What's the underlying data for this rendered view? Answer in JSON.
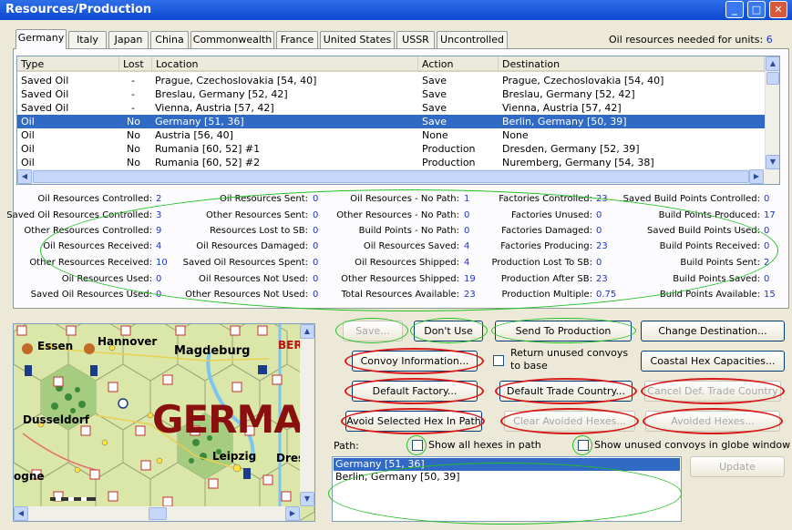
{
  "window": {
    "title": "Resources/Production"
  },
  "tabs": [
    {
      "label": "Germany",
      "active": true
    },
    {
      "label": "Italy"
    },
    {
      "label": "Japan"
    },
    {
      "label": "China"
    },
    {
      "label": "Commonwealth"
    },
    {
      "label": "France"
    },
    {
      "label": "United States"
    },
    {
      "label": "USSR"
    },
    {
      "label": "Uncontrolled"
    }
  ],
  "oil_needed": {
    "label": "Oil resources needed for units:",
    "value": "6"
  },
  "table": {
    "columns": [
      "Type",
      "Lost",
      "Location",
      "Action",
      "Destination"
    ],
    "rows": [
      {
        "type": "Saved Oil",
        "lost": "-",
        "location": "Prague, Czechoslovakia [54, 40]",
        "action": "Save",
        "destination": "Prague, Czechoslovakia [54, 40]"
      },
      {
        "type": "Saved Oil",
        "lost": "-",
        "location": "Breslau, Germany [52, 42]",
        "action": "Save",
        "destination": "Breslau, Germany [52, 42]"
      },
      {
        "type": "Saved Oil",
        "lost": "-",
        "location": "Vienna, Austria [57, 42]",
        "action": "Save",
        "destination": "Vienna, Austria [57, 42]"
      },
      {
        "type": "Oil",
        "lost": "No",
        "location": "Germany [51, 36]",
        "action": "Save",
        "destination": "Berlin, Germany [50, 39]",
        "selected": true
      },
      {
        "type": "Oil",
        "lost": "No",
        "location": "Austria [56, 40]",
        "action": "None",
        "destination": "None"
      },
      {
        "type": "Oil",
        "lost": "No",
        "location": "Rumania [60, 52] #1",
        "action": "Production",
        "destination": "Dresden, Germany [52, 39]"
      },
      {
        "type": "Oil",
        "lost": "No",
        "location": "Rumania [60, 52] #2",
        "action": "Production",
        "destination": "Nuremberg, Germany [54, 38]"
      }
    ]
  },
  "stats": {
    "col1": [
      {
        "label": "Oil Resources Controlled:",
        "value": "2"
      },
      {
        "label": "Saved Oil Resources Controlled:",
        "value": "3"
      },
      {
        "label": "Other Resources Controlled:",
        "value": "9"
      },
      {
        "label": "Oil Resources Received:",
        "value": "4"
      },
      {
        "label": "Other Resources Received:",
        "value": "10"
      },
      {
        "label": "Oil Resources Used:",
        "value": "0"
      },
      {
        "label": "Saved Oil Resources Used:",
        "value": "0"
      }
    ],
    "col2": [
      {
        "label": "Oil Resources Sent:",
        "value": "0"
      },
      {
        "label": "Other Resources Sent:",
        "value": "0"
      },
      {
        "label": "Resources Lost to SB:",
        "value": "0"
      },
      {
        "label": "Oil Resources Damaged:",
        "value": "0"
      },
      {
        "label": "Saved Oil Resources Spent:",
        "value": "0"
      },
      {
        "label": "Oil Resources Not Used:",
        "value": "0"
      },
      {
        "label": "Other Resources Not Used:",
        "value": "0"
      }
    ],
    "col3": [
      {
        "label": "Oil Resources - No Path:",
        "value": "1"
      },
      {
        "label": "Other Resources - No Path:",
        "value": "0"
      },
      {
        "label": "Build Points - No Path:",
        "value": "0"
      },
      {
        "label": "Oil Resources Saved:",
        "value": "4"
      },
      {
        "label": "Oil Resources Shipped:",
        "value": "4"
      },
      {
        "label": "Other Resources Shipped:",
        "value": "19"
      },
      {
        "label": "Total Resources Available:",
        "value": "23"
      }
    ],
    "col4": [
      {
        "label": "Factories Controlled:",
        "value": "23"
      },
      {
        "label": "Factories Unused:",
        "value": "0"
      },
      {
        "label": "Factories Damaged:",
        "value": "0"
      },
      {
        "label": "Factories Producing:",
        "value": "23"
      },
      {
        "label": "Production Lost To SB:",
        "value": "0"
      },
      {
        "label": "Production After SB:",
        "value": "23"
      },
      {
        "label": "Production Multiple:",
        "value": "0.75"
      }
    ],
    "col5": [
      {
        "label": "Saved Build Points Controlled:",
        "value": "0"
      },
      {
        "label": "Build Points Produced:",
        "value": "17"
      },
      {
        "label": "Saved Build Points Used:",
        "value": "0"
      },
      {
        "label": "Build Points Received:",
        "value": "0"
      },
      {
        "label": "Build Points Sent:",
        "value": "2"
      },
      {
        "label": "Build Points Saved:",
        "value": "0"
      },
      {
        "label": "Build Points Available:",
        "value": "15"
      }
    ]
  },
  "buttons": {
    "save": "Save...",
    "dont_use": "Don't Use",
    "send_to_production": "Send To Production",
    "change_destination": "Change Destination...",
    "convoy_information": "Convoy Information...",
    "return_unused": "Return unused convoys to base",
    "coastal_hex": "Coastal Hex Capacities...",
    "default_factory": "Default Factory...",
    "default_trade_country": "Default Trade Country...",
    "cancel_def_trade": "Cancel Def. Trade Country",
    "avoid_selected_hex": "Avoid Selected Hex In Path",
    "clear_avoided": "Clear Avoided Hexes...",
    "avoided_hexes": "Avoided Hexes...",
    "update": "Update"
  },
  "path": {
    "label": "Path:",
    "show_all_hexes": "Show all hexes in path",
    "show_unused_convoys": "Show unused convoys in globe window",
    "items": [
      "Germany [51, 36]",
      "Berlin, Germany [50, 39]"
    ]
  },
  "map": {
    "region_label": "GERMA",
    "cities": [
      "Essen",
      "Hannover",
      "Magdeburg",
      "Dusseldorf",
      "Leipzig",
      "Dres",
      "ogne",
      "BER"
    ]
  }
}
